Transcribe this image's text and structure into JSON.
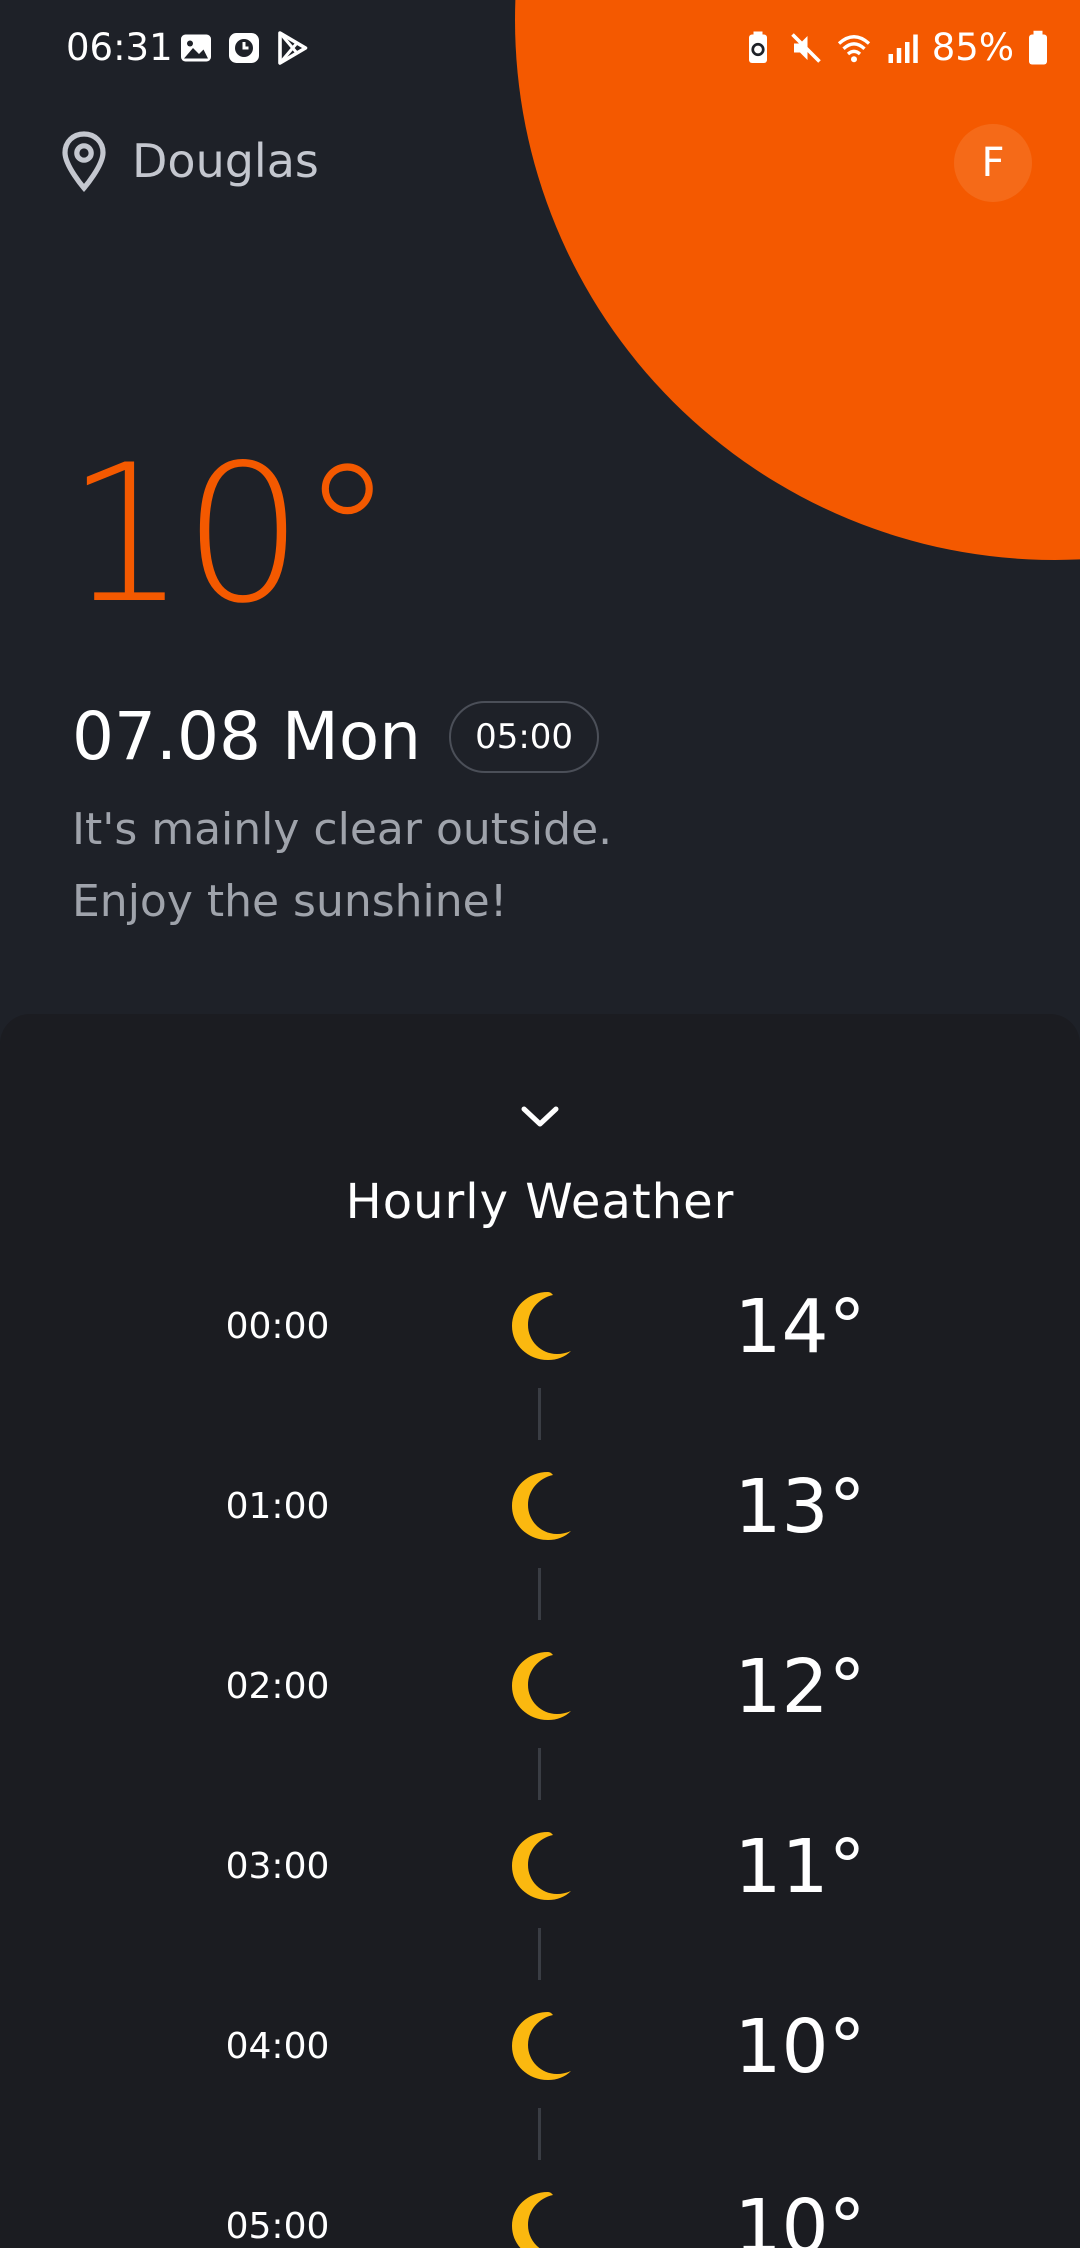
{
  "status_bar": {
    "time": "06:31",
    "battery_percent": "85%",
    "left_icons": [
      "gallery-icon",
      "clock-icon",
      "play-store-icon"
    ],
    "right_icons": [
      "battery-saver-icon",
      "mute-icon",
      "wifi-icon",
      "signal-icon",
      "battery-icon"
    ]
  },
  "header": {
    "location": "Douglas",
    "avatar_initial": "F"
  },
  "current": {
    "temperature": "10°",
    "date": "07.08 Mon",
    "time": "05:00",
    "description_line1": "It's mainly clear outside.",
    "description_line2": "Enjoy the sunshine!"
  },
  "hourly": {
    "title": "Hourly Weather",
    "rows": [
      {
        "time": "00:00",
        "icon": "moon-icon",
        "temp": "14°"
      },
      {
        "time": "01:00",
        "icon": "moon-icon",
        "temp": "13°"
      },
      {
        "time": "02:00",
        "icon": "moon-icon",
        "temp": "12°"
      },
      {
        "time": "03:00",
        "icon": "moon-icon",
        "temp": "11°"
      },
      {
        "time": "04:00",
        "icon": "moon-icon",
        "temp": "10°"
      },
      {
        "time": "05:00",
        "icon": "moon-icon",
        "temp": "10°"
      }
    ]
  },
  "colors": {
    "accent": "#f45900",
    "background": "#1e2128",
    "panel": "#1b1c21",
    "moon": "#fbb80f"
  }
}
